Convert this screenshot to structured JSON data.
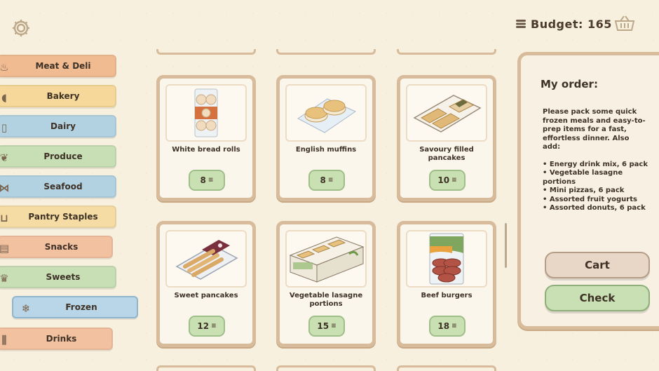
{
  "budget": {
    "label": "Budget: 165"
  },
  "categories": [
    {
      "label": "Meat & Deli",
      "icon": "sausage-icon"
    },
    {
      "label": "Bakery",
      "icon": "bread-icon"
    },
    {
      "label": "Dairy",
      "icon": "milk-icon"
    },
    {
      "label": "Produce",
      "icon": "produce-icon"
    },
    {
      "label": "Seafood",
      "icon": "fish-icon"
    },
    {
      "label": "Pantry Staples",
      "icon": "jars-icon"
    },
    {
      "label": "Snacks",
      "icon": "chips-icon"
    },
    {
      "label": "Sweets",
      "icon": "cupcake-icon"
    },
    {
      "label": "Frozen",
      "icon": "snowflake-icon"
    },
    {
      "label": "Drinks",
      "icon": "bottle-icon"
    }
  ],
  "selected_category": "Frozen",
  "products": [
    {
      "name": "White bread rolls",
      "price": "8"
    },
    {
      "name": "English muffins",
      "price": "8"
    },
    {
      "name": "Savoury filled pancakes",
      "price": "10"
    },
    {
      "name": "Sweet pancakes",
      "price": "12"
    },
    {
      "name": "Vegetable lasagne portions",
      "price": "15"
    },
    {
      "name": "Beef burgers",
      "price": "18"
    }
  ],
  "order": {
    "title": "My order:",
    "intro": "Please pack some quick frozen meals and easy-to-prep items for a fast, effortless dinner. Also add:",
    "items": [
      "• Energy drink mix, 6 pack",
      "• Vegetable lasagne portions",
      "• Mini pizzas, 6 pack",
      "• Assorted fruit yogurts",
      "• Assorted donuts, 6 pack"
    ],
    "cart_label": "Cart",
    "check_label": "Check"
  },
  "colors": {
    "background": "#f8f0df",
    "card_border": "#d7bb9b",
    "price_green": "#c9e0b3",
    "selected_blue": "#b9d6e8"
  }
}
